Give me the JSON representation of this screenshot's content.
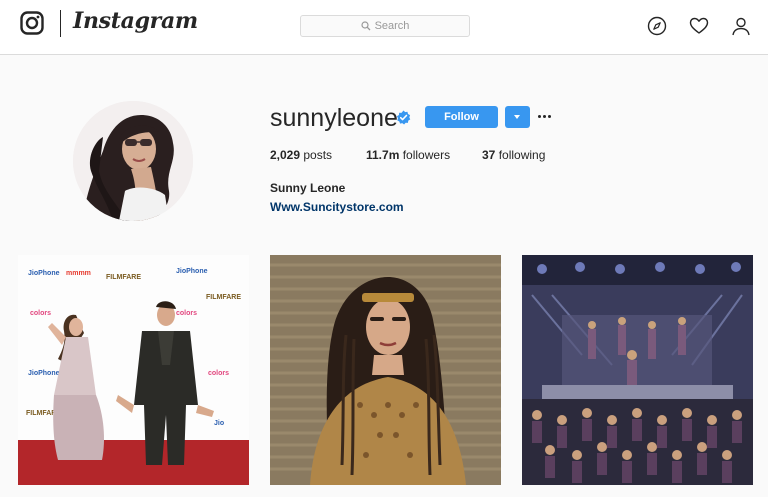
{
  "brand": {
    "wordmark": "Instagram",
    "logo_icon": "instagram-camera-icon"
  },
  "search": {
    "placeholder": "Search",
    "icon": "search-icon"
  },
  "nav": {
    "icons": [
      "compass-icon",
      "heart-icon",
      "profile-icon"
    ]
  },
  "profile": {
    "username": "sunnyleone",
    "verified": true,
    "follow_label": "Follow",
    "stats": {
      "posts_count": "2,029",
      "posts_label": "posts",
      "followers_count": "11.7m",
      "followers_label": "followers",
      "following_count": "37",
      "following_label": "following"
    },
    "full_name": "Sunny Leone",
    "website": "Www.Suncitystore.com"
  },
  "posts": [
    {
      "kind": "photo",
      "subject": "red carpet couple"
    },
    {
      "kind": "photo",
      "subject": "portrait with headband"
    },
    {
      "kind": "photo",
      "subject": "stage dance performance"
    }
  ],
  "colors": {
    "accent": "#3897f0",
    "link": "#003569",
    "text": "#262626",
    "border": "#dbdbdb",
    "background": "#fafafa"
  }
}
